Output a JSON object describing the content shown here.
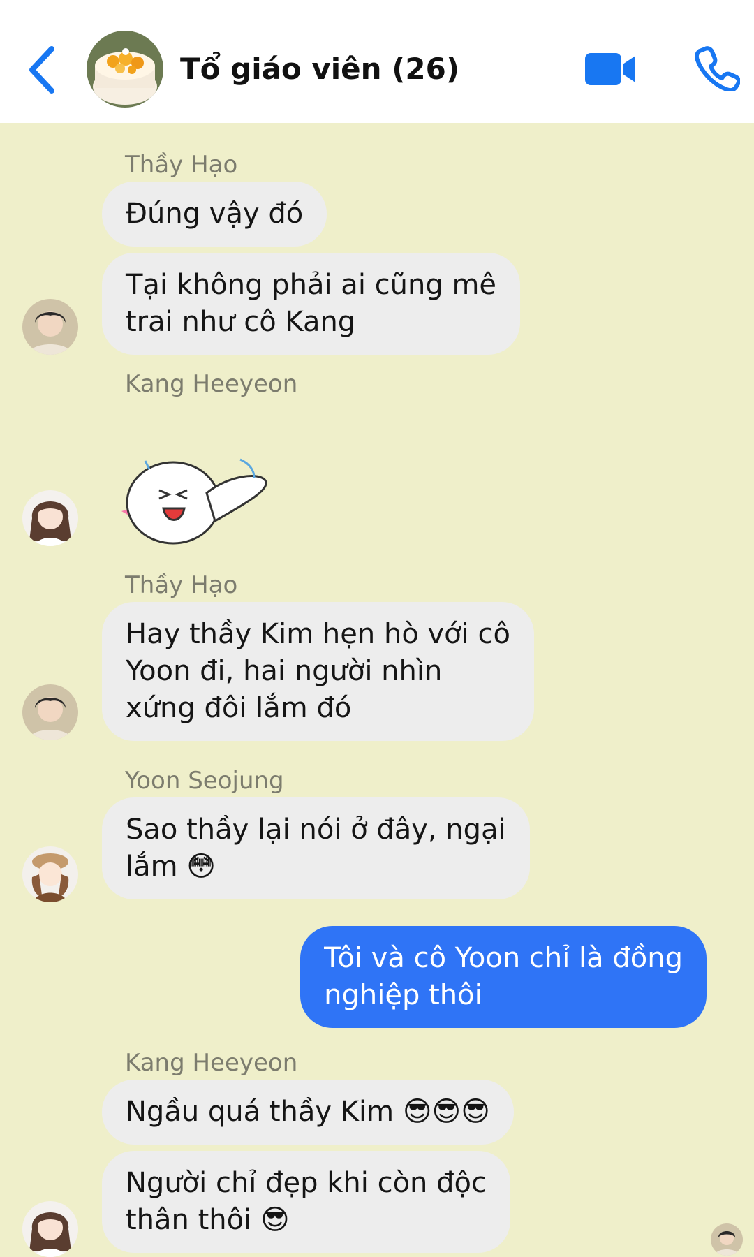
{
  "header": {
    "title": "Tổ giáo viên (26)",
    "back_icon": "chevron-left-icon",
    "video_icon": "video-camera-icon",
    "call_icon": "phone-icon"
  },
  "colors": {
    "accent": "#1877f2",
    "chat_background": "#efefca",
    "incoming_bubble": "#ededed",
    "outgoing_bubble": "#2f74f6"
  },
  "messages": [
    {
      "sender": "Thầy Hạo",
      "text": "Đúng vậy đó"
    },
    {
      "text": "Tại không phải ai cũng mê\ntrai như cô Kang"
    },
    {
      "sender": "Kang Heeyeon",
      "sticker": "laughing-sticker"
    },
    {
      "sender": "Thầy Hạo",
      "text": "Hay thầy Kim hẹn hò với cô\nYoon đi, hai người nhìn\nxứng đôi lắm đó"
    },
    {
      "sender": "Yoon Seojung",
      "text": "Sao thầy lại nói ở đây, ngại\nlắm 😳"
    },
    {
      "text": "Tôi và cô Yoon chỉ là đồng\nnghiệp thôi",
      "outgoing": true
    },
    {
      "sender": "Kang Heeyeon",
      "text": "Ngầu quá thầy Kim 😎😎😎"
    },
    {
      "text": "Người chỉ đẹp khi còn độc\nthân thôi 😎"
    }
  ]
}
